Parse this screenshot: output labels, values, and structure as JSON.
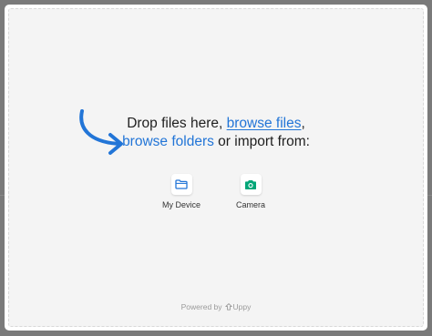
{
  "dropzone": {
    "prompt_part1": "Drop files here, ",
    "browse_files": "browse files",
    "comma": ",",
    "browse_folders": "browse folders",
    "prompt_part2": " or import from:"
  },
  "providers": [
    {
      "label": "My Device",
      "icon": "folder-icon",
      "color": "#2275d7"
    },
    {
      "label": "Camera",
      "icon": "camera-icon",
      "color": "#03a678"
    }
  ],
  "footer": {
    "powered_by": "Powered by",
    "brand": "Uppy"
  },
  "colors": {
    "accent": "#2275d7",
    "camera": "#03a678",
    "arrow": "#2275d7"
  }
}
